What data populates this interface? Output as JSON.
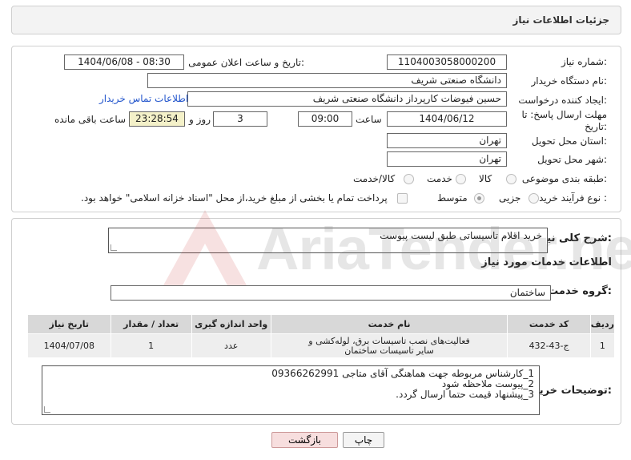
{
  "header": {
    "title": "جزئیات اطلاعات نیاز"
  },
  "form": {
    "need_number": {
      "label": "شماره نیاز:",
      "value": "1104003058000200"
    },
    "announce_datetime": {
      "label": "تاریخ و ساعت اعلان عمومی:",
      "value": "1404/06/08 - 08:30"
    },
    "buyer_org": {
      "label": "نام دستگاه خریدار:",
      "value": "دانشگاه صنعتی شریف"
    },
    "requester": {
      "label": "ایجاد کننده درخواست:",
      "value": "حسین فیوضات کارپرداز دانشگاه صنعتی شریف",
      "contact_link": "اطلاعات تماس خریدار"
    },
    "deadline": {
      "label": "مهلت ارسال پاسخ: تا تاریخ:",
      "date": "1404/06/12",
      "time_label": "ساعت",
      "time": "09:00",
      "days": "3",
      "days_label": "روز و",
      "remaining": "23:28:54",
      "remaining_label": "ساعت باقی مانده"
    },
    "province": {
      "label": "استان محل تحویل:",
      "value": "تهران"
    },
    "city": {
      "label": "شهر محل تحویل:",
      "value": "تهران"
    },
    "category": {
      "label": "طبقه بندی موضوعی:",
      "options": [
        "کالا",
        "خدمت",
        "کالا/خدمت"
      ]
    },
    "purchase_type": {
      "label": "نوع فرآیند خرید :",
      "options": [
        "جزیی",
        "متوسط"
      ],
      "payment_note": "پرداخت تمام یا بخشی از مبلغ خرید،از محل \"اسناد خزانه اسلامی\" خواهد بود."
    }
  },
  "summary": {
    "label": "شرح کلی نیاز:",
    "value": "خرید اقلام تاسیساتی طبق لیست پیوست"
  },
  "services": {
    "section_title": "اطلاعات خدمات مورد نیاز",
    "group_label": "گروه خدمت:",
    "group_value": "ساختمان",
    "columns": [
      "ردیف",
      "کد خدمت",
      "نام خدمت",
      "واحد اندازه گیری",
      "تعداد / مقدار",
      "تاریخ نیاز"
    ],
    "rows": [
      {
        "row": "1",
        "code": "ج-43-432",
        "name": "فعالیت‌های نصب تاسیسات برق، لوله‌کشی و سایر تاسیسات ساختمان",
        "unit": "عدد",
        "qty": "1",
        "date": "1404/07/08"
      }
    ]
  },
  "buyer_notes": {
    "label": "توضیحات خریدار:",
    "lines": [
      "1_کارشناس مربوطه جهت هماهنگی آقای متاجی 09366262991",
      "2_پیوست ملاحظه شود",
      "3_پیشنهاد قیمت حتما ارسال گردد."
    ]
  },
  "buttons": {
    "print": "چاپ",
    "back": "بازگشت"
  }
}
